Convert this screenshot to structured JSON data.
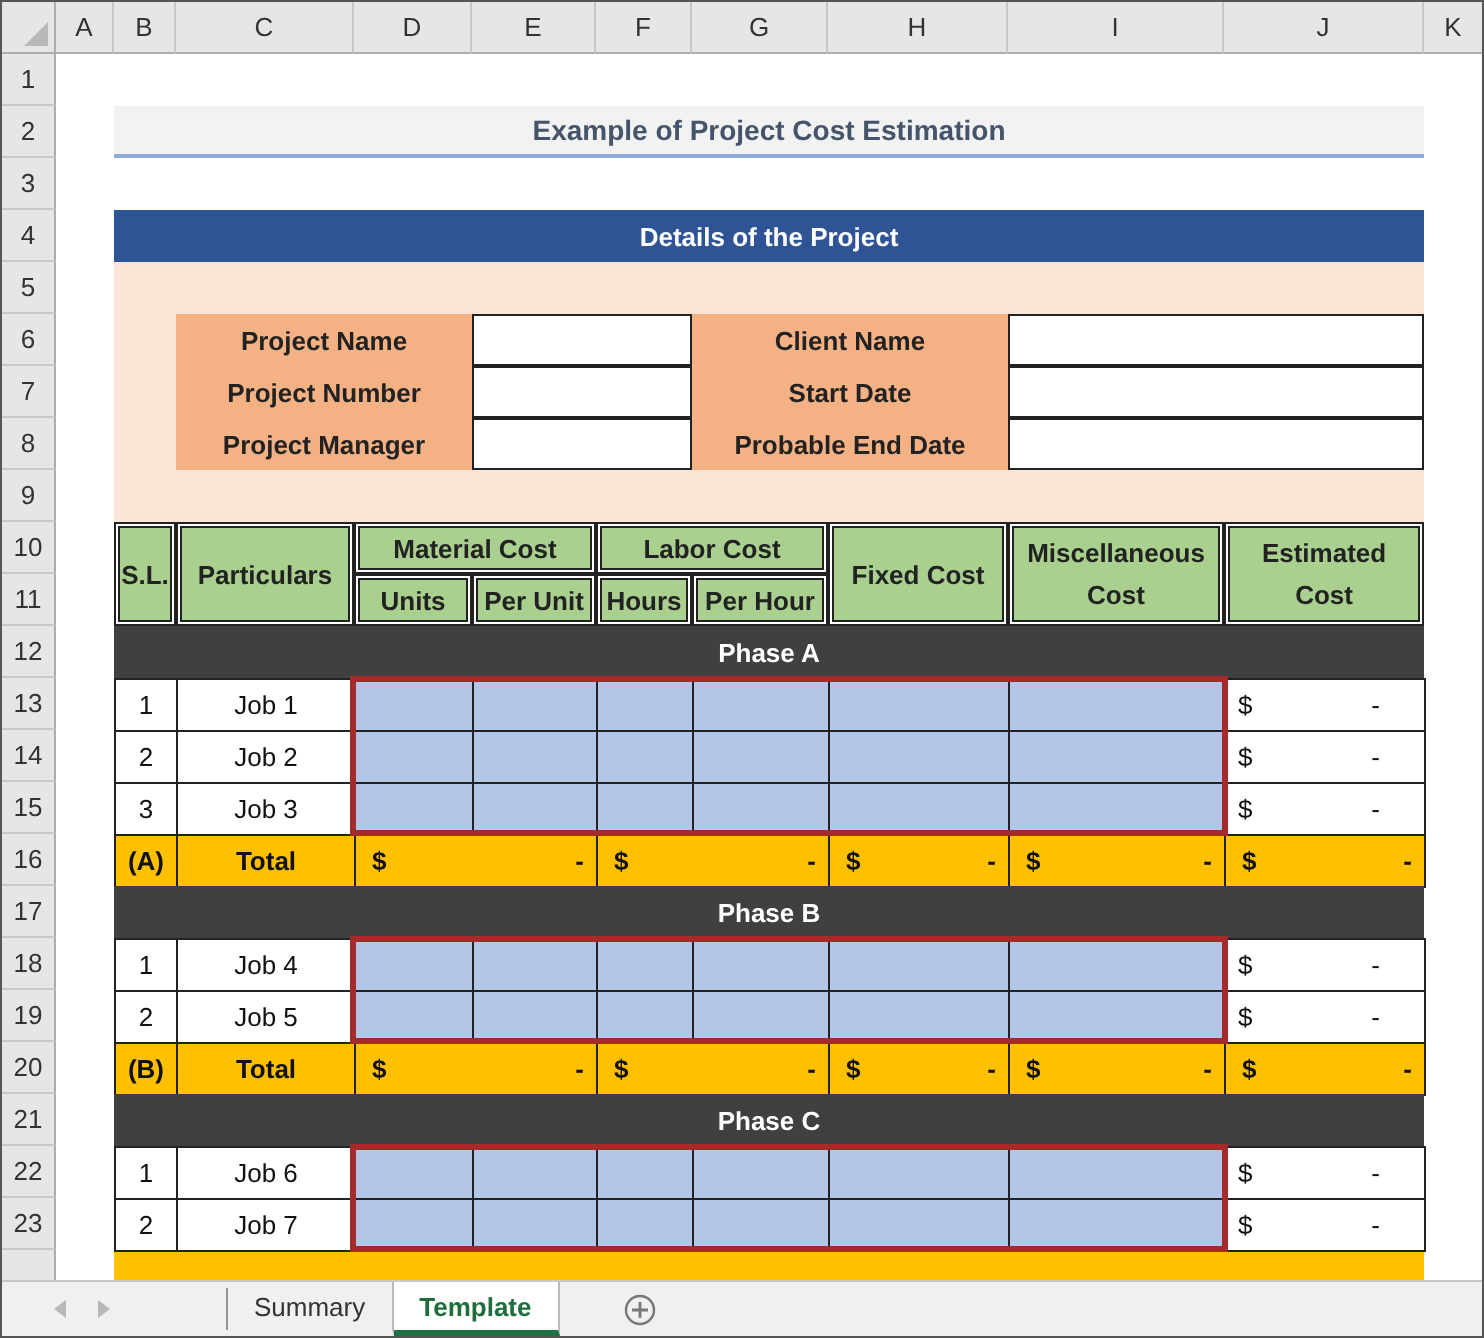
{
  "columns": [
    "A",
    "B",
    "C",
    "D",
    "E",
    "F",
    "G",
    "H",
    "I",
    "J",
    "K"
  ],
  "rows": [
    "1",
    "2",
    "3",
    "4",
    "5",
    "6",
    "7",
    "8",
    "9",
    "10",
    "11",
    "12",
    "13",
    "14",
    "15",
    "16",
    "17",
    "18",
    "19",
    "20",
    "21",
    "22",
    "23"
  ],
  "title": "Example of Project Cost Estimation",
  "details": {
    "header": "Details of the Project",
    "left_fields": [
      {
        "label": "Project Name"
      },
      {
        "label": "Project Number"
      },
      {
        "label": "Project Manager"
      }
    ],
    "right_fields": [
      {
        "label": "Client Name"
      },
      {
        "label": "Start Date"
      },
      {
        "label": "Probable End Date"
      }
    ]
  },
  "table_header": {
    "sl": "S.L.",
    "particulars": "Particulars",
    "material": "Material Cost",
    "units": "Units",
    "per_unit": "Per Unit",
    "labor": "Labor Cost",
    "hours": "Hours",
    "per_hour": "Per Hour",
    "fixed": "Fixed Cost",
    "misc": "Miscellaneous Cost",
    "estimated": "Estimated Cost"
  },
  "phases": [
    {
      "name": "Phase A",
      "jobs": [
        {
          "sl": "1",
          "name": "Job 1",
          "currency": "$",
          "estimated": "-"
        },
        {
          "sl": "2",
          "name": "Job 2",
          "currency": "$",
          "estimated": "-"
        },
        {
          "sl": "3",
          "name": "Job 3",
          "currency": "$",
          "estimated": "-"
        }
      ],
      "total": {
        "code": "(A)",
        "label": "Total",
        "amounts": [
          {
            "currency": "$",
            "value": "-"
          },
          {
            "currency": "$",
            "value": "-"
          },
          {
            "currency": "$",
            "value": "-"
          },
          {
            "currency": "$",
            "value": "-"
          },
          {
            "currency": "$",
            "value": "-"
          }
        ]
      }
    },
    {
      "name": "Phase B",
      "jobs": [
        {
          "sl": "1",
          "name": "Job 4",
          "currency": "$",
          "estimated": "-"
        },
        {
          "sl": "2",
          "name": "Job 5",
          "currency": "$",
          "estimated": "-"
        }
      ],
      "total": {
        "code": "(B)",
        "label": "Total",
        "amounts": [
          {
            "currency": "$",
            "value": "-"
          },
          {
            "currency": "$",
            "value": "-"
          },
          {
            "currency": "$",
            "value": "-"
          },
          {
            "currency": "$",
            "value": "-"
          },
          {
            "currency": "$",
            "value": "-"
          }
        ]
      }
    },
    {
      "name": "Phase C",
      "jobs": [
        {
          "sl": "1",
          "name": "Job 6",
          "currency": "$",
          "estimated": "-"
        },
        {
          "sl": "2",
          "name": "Job 7",
          "currency": "$",
          "estimated": "-"
        }
      ]
    }
  ],
  "sheet_tabs": [
    {
      "label": "Summary",
      "selected": false
    },
    {
      "label": "Template",
      "selected": true
    }
  ]
}
